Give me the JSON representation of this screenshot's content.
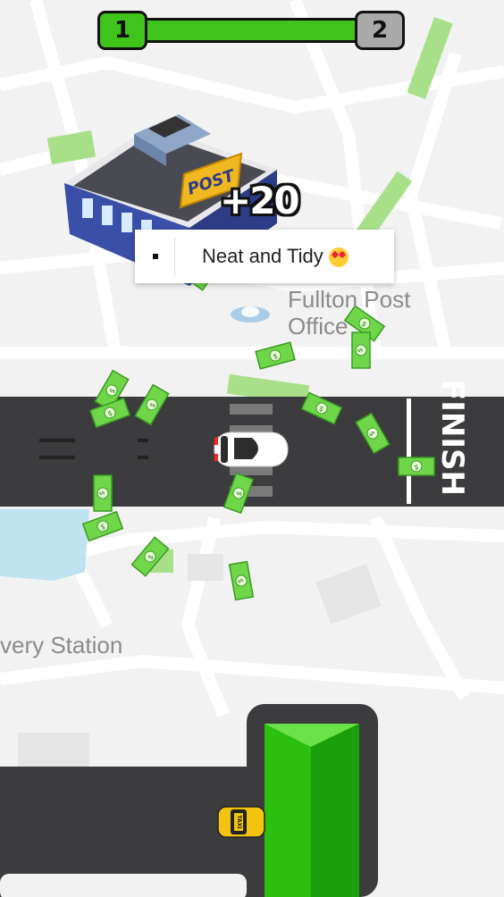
{
  "hud": {
    "current_level": "1",
    "next_level": "2",
    "progress": 1.0
  },
  "bonus_popup": "+20",
  "toast": {
    "message": "Neat and Tidy"
  },
  "map_labels": {
    "post_office_line1": "Fullton Post",
    "post_office_line2": "Office",
    "station": "very Station"
  },
  "building_sign": "POST",
  "finish_label": "FINISH",
  "taxi_label": "TAXI",
  "colors": {
    "road": "#3c3b3d",
    "grass": "#3ec41a",
    "map_bg": "#f2f2f2",
    "water": "#bfe2f0",
    "cash": "#6fd64a"
  }
}
